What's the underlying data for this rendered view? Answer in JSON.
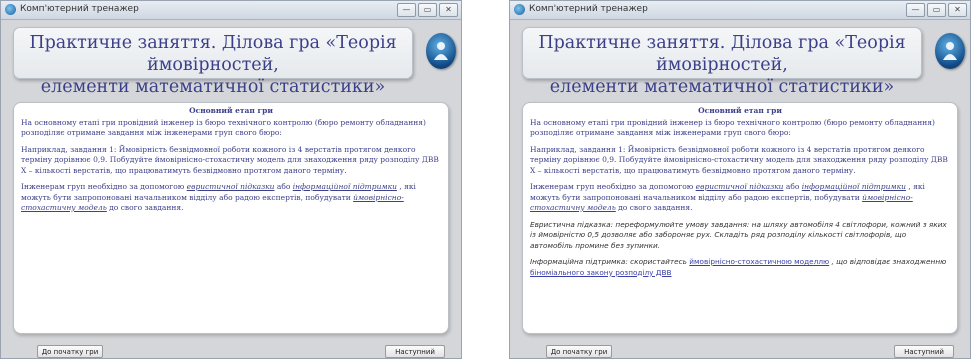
{
  "window": {
    "title": "Комп'ютерний тренажер",
    "controls": [
      "—",
      "▭",
      "✕"
    ]
  },
  "header": {
    "line1": "Практичне заняття. Ділова гра «Теорія ймовірностей,",
    "line2": "елементи математичної статистики»"
  },
  "content": {
    "section_title": "Основний етап гри",
    "para1": "На основному етапі гри провідний інженер із бюро технічного контролю (бюро ремонту обладнання) розподіляє отримане завдання між інженерами груп свого бюро:",
    "para2": "Наприклад, завдання 1: Ймовірність безвідмовної роботи кожного із 4 верстатів протягом деякого терміну дорівнює 0,9. Побудуйте ймовірнісно-стохастичну модель для знаходження  ряду розподілу ДВВ Х – кількості верстатів, що працюватимуть безвідмовно протягом даного терміну.",
    "para3_a": "Інженерам груп необхідно за допомогою ",
    "link_heuristic": "евристичної підказки",
    "para3_b": " або ",
    "link_info": "інформаційної підтримки",
    "para3_c": " , які можуть бути запропоновані начальником відділу або радою експертів, побудувати ",
    "link_model": "ймовірнісно-стохастичну модель",
    "para3_d": " до свого завдання.",
    "hint": "Евристична підказка: переформулюйте умову завдання: на шляху автомобіля 4 світлофори, кожний з яких із ймовірністю 0,5 дозволяє або забороняє рух. Складіть ряд розподілу кількості світлофорів, що автомобіль промине без зупинки.",
    "support_a": "Інформаційна підтримка: скористайтесь ",
    "support_link1": "ймовірнісно-стохастичною моделлю",
    "support_b": " , що відповідає знаходженню ",
    "support_link2": "біноміального закону розподілу ДВВ"
  },
  "buttons": {
    "start": "До початку гри",
    "next": "Наступний етап"
  }
}
